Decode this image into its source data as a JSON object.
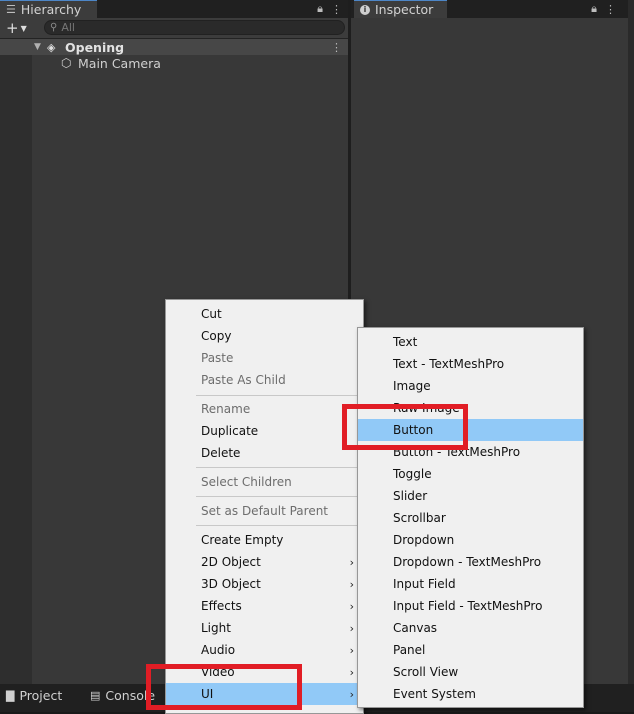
{
  "hierarchy": {
    "tab_label": "Hierarchy",
    "search_placeholder": "All",
    "scene_name": "Opening",
    "items": [
      {
        "label": "Main Camera"
      }
    ]
  },
  "inspector": {
    "tab_label": "Inspector"
  },
  "bottom_tabs": [
    {
      "label": "Project"
    },
    {
      "label": "Console"
    }
  ],
  "context_menu": {
    "items": [
      {
        "label": "Cut"
      },
      {
        "label": "Copy"
      },
      {
        "label": "Paste"
      },
      {
        "label": "Paste As Child"
      },
      {
        "label": "Rename"
      },
      {
        "label": "Duplicate"
      },
      {
        "label": "Delete"
      },
      {
        "label": "Select Children"
      },
      {
        "label": "Set as Default Parent"
      },
      {
        "label": "Create Empty"
      },
      {
        "label": "2D Object"
      },
      {
        "label": "3D Object"
      },
      {
        "label": "Effects"
      },
      {
        "label": "Light"
      },
      {
        "label": "Audio"
      },
      {
        "label": "Video"
      },
      {
        "label": "UI"
      }
    ]
  },
  "ui_submenu": {
    "items": [
      {
        "label": "Text"
      },
      {
        "label": "Text - TextMeshPro"
      },
      {
        "label": "Image"
      },
      {
        "label": "Raw Image"
      },
      {
        "label": "Button"
      },
      {
        "label": "Button - TextMeshPro"
      },
      {
        "label": "Toggle"
      },
      {
        "label": "Slider"
      },
      {
        "label": "Scrollbar"
      },
      {
        "label": "Dropdown"
      },
      {
        "label": "Dropdown - TextMeshPro"
      },
      {
        "label": "Input Field"
      },
      {
        "label": "Input Field - TextMeshPro"
      },
      {
        "label": "Canvas"
      },
      {
        "label": "Panel"
      },
      {
        "label": "Scroll View"
      },
      {
        "label": "Event System"
      }
    ]
  },
  "colors": {
    "highlight": "#91c9f7",
    "annotation_red": "#e11d25",
    "panel_bg": "#383838"
  }
}
